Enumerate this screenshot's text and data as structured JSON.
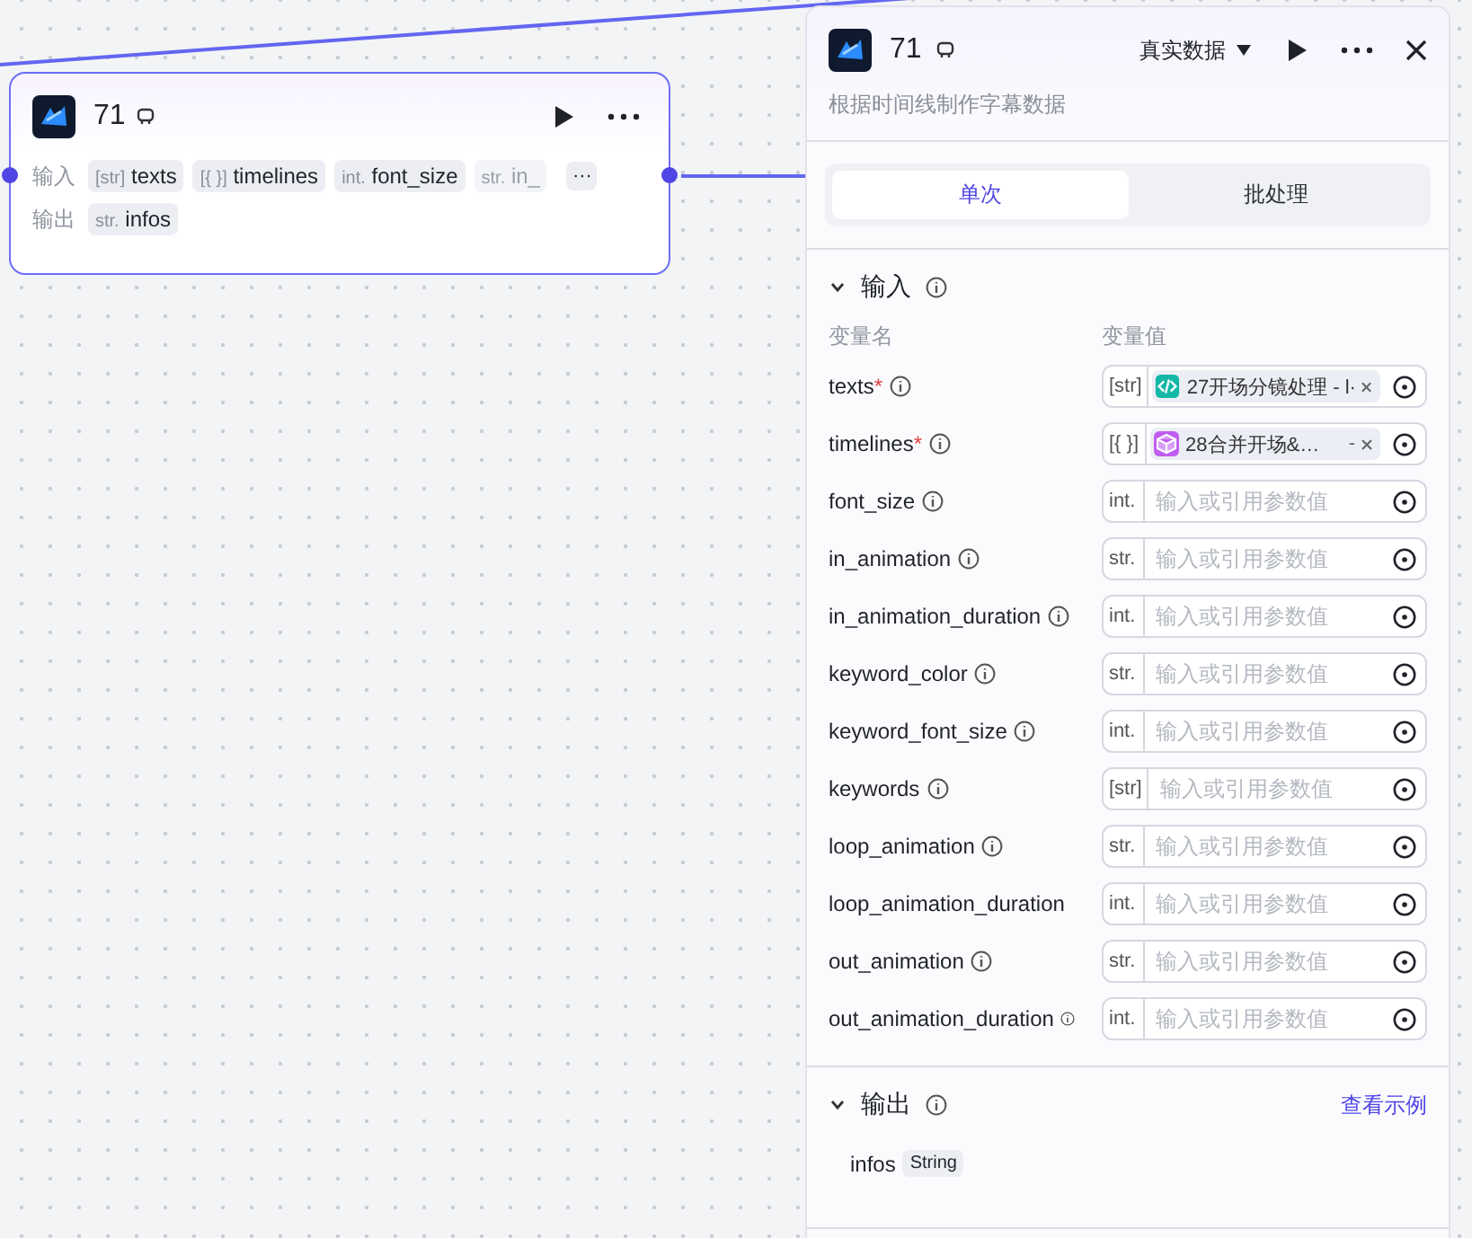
{
  "node": {
    "title": "71",
    "inputs_label": "输入",
    "outputs_label": "输出",
    "inputs": [
      {
        "type": "[str]",
        "name": "texts",
        "faded": false
      },
      {
        "type": "[{ }]",
        "name": "timelines",
        "faded": false
      },
      {
        "type": "int.",
        "name": "font_size",
        "faded": false
      },
      {
        "type": "str.",
        "name": "in_",
        "faded": true
      }
    ],
    "more": "···",
    "outputs": [
      {
        "type": "str.",
        "name": "infos"
      }
    ]
  },
  "panel": {
    "title": "71",
    "data_mode": "真实数据",
    "description": "根据时间线制作字幕数据",
    "tabs": [
      {
        "label": "单次",
        "selected": true
      },
      {
        "label": "批处理",
        "selected": false
      }
    ],
    "input_section": {
      "title": "输入",
      "expanded": true,
      "name_header": "变量名",
      "required_mark": "*",
      "value_header": "变量值",
      "params": [
        {
          "name": "texts",
          "required": true,
          "info": true,
          "type": "[str]",
          "ref": {
            "kind": "code",
            "color": "#14b8a6",
            "label": "27开场分镜处理 - l·"
          }
        },
        {
          "name": "timelines",
          "required": true,
          "info": true,
          "type": "[{ }]",
          "ref": {
            "kind": "box",
            "color": "#c05cf0",
            "label": "28合并开场&…",
            "suffix": "-"
          }
        },
        {
          "name": "font_size",
          "required": false,
          "info": true,
          "type": "int.",
          "placeholder": "输入或引用参数值"
        },
        {
          "name": "in_animation",
          "required": false,
          "info": true,
          "type": "str.",
          "placeholder": "输入或引用参数值"
        },
        {
          "name": "in_animation_duration",
          "required": false,
          "info": true,
          "type": "int.",
          "placeholder": "输入或引用参数值"
        },
        {
          "name": "keyword_color",
          "required": false,
          "info": true,
          "type": "str.",
          "placeholder": "输入或引用参数值"
        },
        {
          "name": "keyword_font_size",
          "required": false,
          "info": true,
          "type": "int.",
          "placeholder": "输入或引用参数值"
        },
        {
          "name": "keywords",
          "required": false,
          "info": true,
          "type": "[str]",
          "placeholder": "输入或引用参数值"
        },
        {
          "name": "loop_animation",
          "required": false,
          "info": true,
          "type": "str.",
          "placeholder": "输入或引用参数值"
        },
        {
          "name": "loop_animation_duration",
          "required": false,
          "info": false,
          "type": "int.",
          "placeholder": "输入或引用参数值"
        },
        {
          "name": "out_animation",
          "required": false,
          "info": true,
          "type": "str.",
          "placeholder": "输入或引用参数值"
        },
        {
          "name": "out_animation_duration",
          "required": false,
          "info": true,
          "type": "int.",
          "placeholder": "输入或引用参数值"
        }
      ]
    },
    "output_section": {
      "title": "输出",
      "expanded": true,
      "example_link": "查看示例",
      "outputs": [
        {
          "name": "infos",
          "type": "String"
        }
      ]
    }
  }
}
